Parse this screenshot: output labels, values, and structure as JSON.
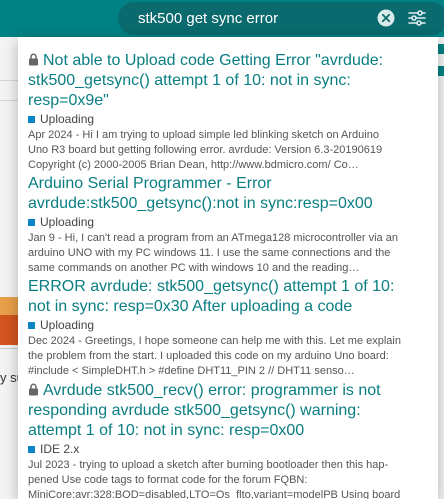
{
  "search": {
    "query": "stk500 get sync error"
  },
  "background": {
    "partial_text": "y su"
  },
  "results": [
    {
      "locked": true,
      "title_lines": [
        "Not able to Upload code Getting Error \"avrdude:",
        "stk500_getsync() attempt 1 of 10: not in sync:",
        "resp=0x9e\""
      ],
      "category": "Uploading",
      "category_color": "#0a86c8",
      "blurb_lines": [
        "Apr 2024 - Hi I am trying to upload simple led blinking sketch on Arduino",
        "Uno R3 board but getting following error. avrdude: Version 6.3-20190619",
        "Copyright (c) 2000-2005 Brian Dean, http://www.bdmicro.com/ Co…"
      ]
    },
    {
      "locked": false,
      "title_lines": [
        "Arduino Serial Programmer - Error",
        "avrdude:stk500_getsync():not in sync:resp=0x00"
      ],
      "category": "Uploading",
      "category_color": "#0a86c8",
      "blurb_lines": [
        "Jan 9 - Hi, I can't read a program from an ATmega128 microcontroller via an",
        "arduino UNO with my PC windows 11. I use the same connections and the",
        "same commands on another PC with windows 10 and the reading…"
      ]
    },
    {
      "locked": false,
      "title_lines": [
        "ERROR avrdude: stk500_getsync() attempt 1 of 10:",
        "not in sync: resp=0x30 After uploading a code"
      ],
      "category": "Uploading",
      "category_color": "#0a86c8",
      "blurb_lines": [
        "Dec 2024 - Greetings, I hope someone can help me with this. Let me explain",
        "the problem from the start. I uploaded this code on my arduino Uno board:",
        "#include < SimpleDHT.h > #define DHT11_PIN 2 // DHT11 senso…"
      ]
    },
    {
      "locked": true,
      "title_lines": [
        "Avrdude stk500_recv() error: programmer is not",
        "responding avrdude stk500_getsync() warning:",
        "attempt 1 of 10: not in sync: resp=0x00"
      ],
      "category": "IDE 2.x",
      "category_color": "#0a86c8",
      "blurb_lines": [
        "Jul 2023 - trying to upload a sketch after burning bootloader then this hap-",
        "pened Use code tags to format code for the forum FQBN:",
        "MiniCore:avr:328:BOD=disabled,LTO=Os_flto,variant=modelPB Using board"
      ]
    }
  ]
}
